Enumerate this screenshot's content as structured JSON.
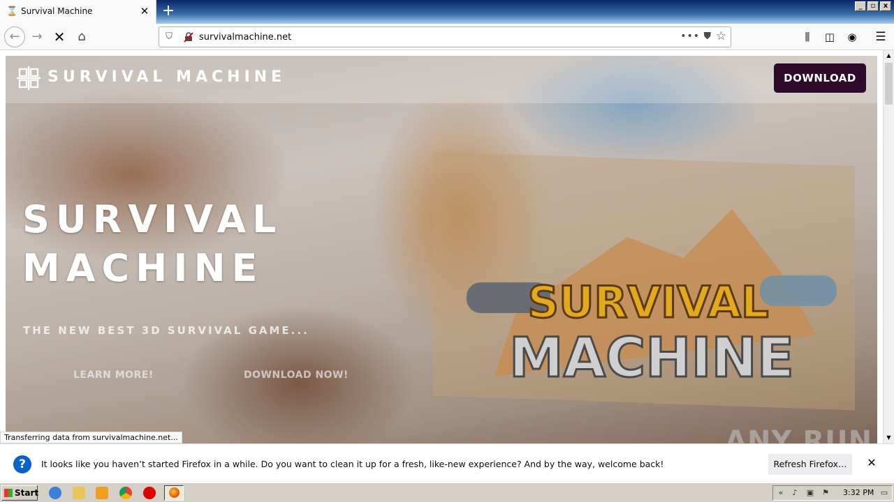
{
  "browser": {
    "tab": {
      "title": "Survival Machine",
      "icon": "hourglass-icon"
    },
    "url": "survivalmachine.net",
    "status_text": "Transferring data from survivalmachine.net..."
  },
  "site": {
    "logo_text": "SURVIVAL MACHINE",
    "download_label": "DOWNLOAD",
    "hero_title": "SURVIVAL MACHINE",
    "hero_subtitle": "THE NEW BEST 3D SURVIVAL GAME...",
    "learn_more": "LEARN MORE!",
    "download_now": "DOWNLOAD NOW!",
    "game_logo_line1": "SURVIVAL",
    "game_logo_line2": "MACHINE"
  },
  "notification": {
    "text": "It looks like you haven’t started Firefox in a while. Do you want to clean it up for a fresh, like-new experience? And by the way, welcome back!",
    "button": "Refresh Firefox…"
  },
  "watermark": "ANY RUN",
  "taskbar": {
    "start_label": "Start",
    "clock": "3:32 PM"
  },
  "colors": {
    "download_button": "#2d0a2a",
    "notification_icon": "#0a63c9"
  }
}
